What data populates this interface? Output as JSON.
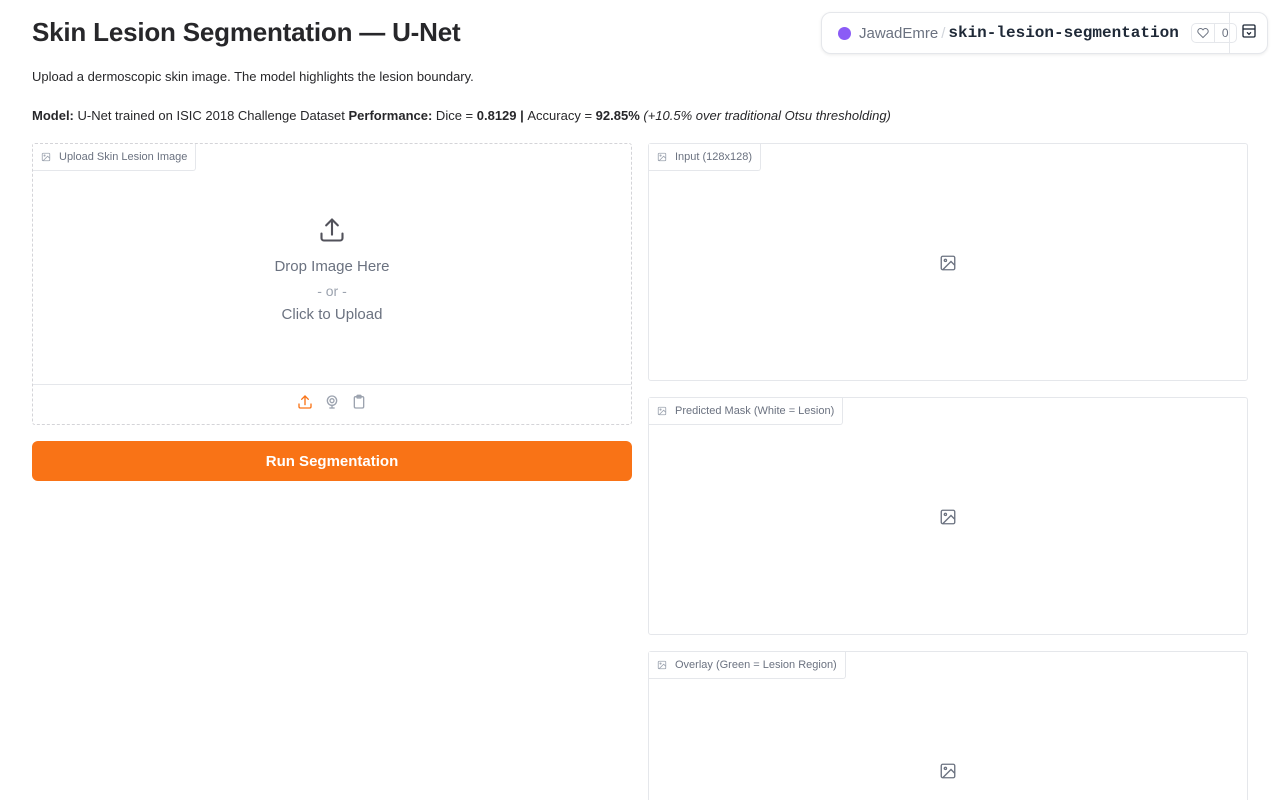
{
  "title": "Skin Lesion Segmentation — U-Net",
  "subtitle": "Upload a dermoscopic skin image. The model highlights the lesion boundary.",
  "model_info": {
    "model_label": "Model:",
    "model_text": " U-Net trained on ISIC 2018 Challenge Dataset ",
    "performance_label": "Performance:",
    "dice_prefix": " Dice = ",
    "dice_value": "0.8129",
    "separator": " | ",
    "accuracy_prefix": "Accuracy = ",
    "accuracy_value": "92.85%",
    "improvement_note": " (+10.5% over traditional Otsu thresholding)"
  },
  "hf_badge": {
    "owner": "JawadEmre",
    "slash": "/",
    "repo": "skin-lesion-segmentation",
    "likes": "0",
    "dot_color": "#8b5cf6"
  },
  "upload": {
    "label": "Upload Skin Lesion Image",
    "drop_text": "Drop Image Here",
    "or_text": "- or -",
    "click_text": "Click to Upload"
  },
  "run_button": {
    "label": "Run Segmentation",
    "color": "#f97316"
  },
  "outputs": [
    {
      "label": "Input (128x128)"
    },
    {
      "label": "Predicted Mask (White = Lesion)"
    },
    {
      "label": "Overlay (Green = Lesion Region)"
    }
  ],
  "icons": {
    "upload": "upload-icon",
    "webcam": "webcam-icon",
    "clipboard": "clipboard-icon",
    "image": "image-icon",
    "heart": "heart-icon",
    "embed": "embed-icon"
  }
}
